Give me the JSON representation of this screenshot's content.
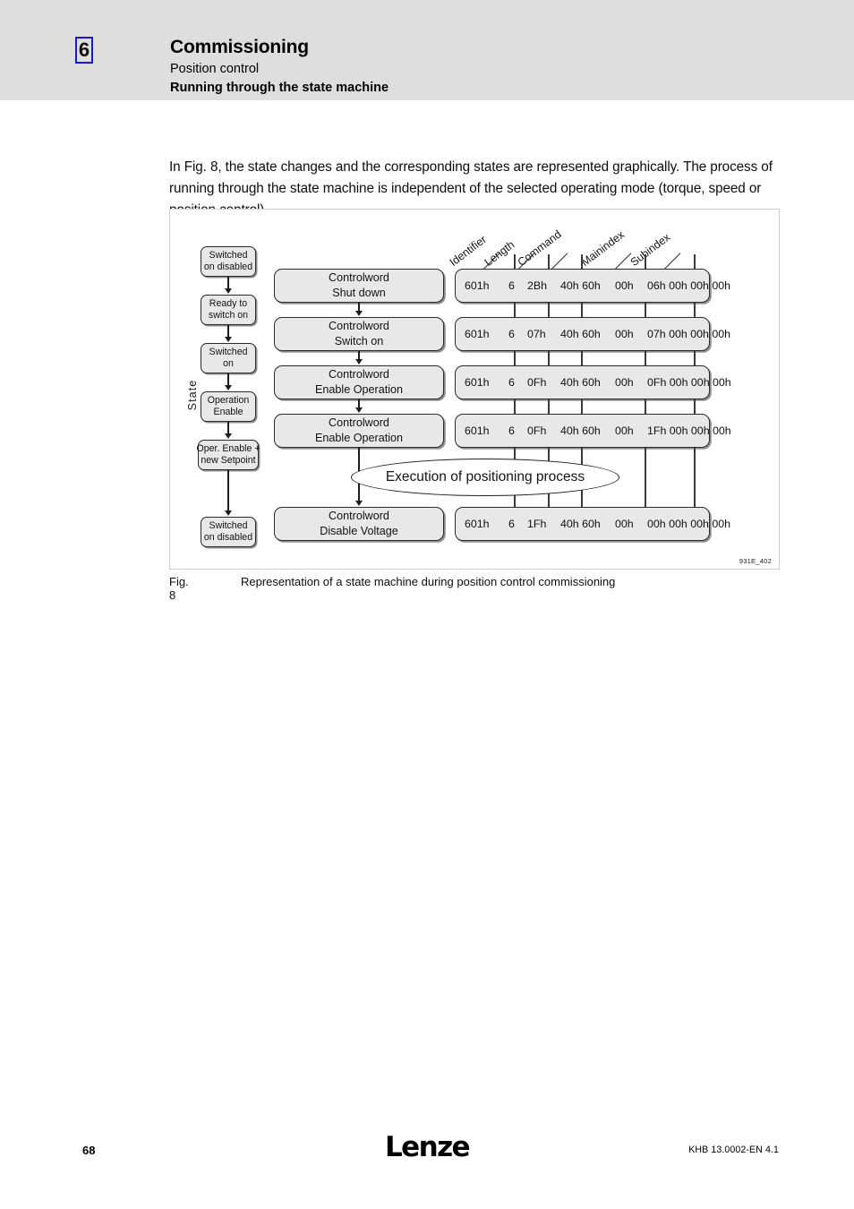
{
  "header": {
    "chapter_number": "6",
    "title": "Commissioning",
    "subtitle_1": "Position control",
    "subtitle_2": "Running through the state machine"
  },
  "body": {
    "intro_paragraph": "In Fig. 8, the state changes and the corresponding states are represented graphically. The process of running through the state machine is independent of the selected operating mode (torque, speed or position control)."
  },
  "figure": {
    "id_label": "931E_402",
    "axis_label": "State",
    "ellipse_label": "Execution of positioning process",
    "column_headers": [
      "Identifier",
      "Length",
      "Command",
      "Mainindex",
      "Subindex"
    ],
    "states": [
      {
        "line1": "Switched",
        "line2": "on disabled"
      },
      {
        "line1": "Ready to",
        "line2": "switch on"
      },
      {
        "line1": "Switched",
        "line2": "on"
      },
      {
        "line1": "Operation",
        "line2": "Enable"
      },
      {
        "line1": "Oper. Enable +",
        "line2": "new Setpoint"
      },
      {
        "line1": "Switched",
        "line2": "on disabled"
      }
    ],
    "controlwords": [
      {
        "line1": "Controlword",
        "line2": "Shut down"
      },
      {
        "line1": "Controlword",
        "line2": "Switch on"
      },
      {
        "line1": "Controlword",
        "line2": "Enable Operation"
      },
      {
        "line1": "Controlword",
        "line2": "Enable Operation"
      },
      {
        "line1": "Controlword",
        "line2": "Disable Voltage"
      }
    ],
    "telegrams": [
      {
        "identifier": "601h",
        "length": "6",
        "command": "2Bh",
        "mainindex": "40h 60h",
        "subindex": "00h",
        "data": "06h 00h 00h 00h"
      },
      {
        "identifier": "601h",
        "length": "6",
        "command": "07h",
        "mainindex": "40h 60h",
        "subindex": "00h",
        "data": "07h 00h 00h 00h"
      },
      {
        "identifier": "601h",
        "length": "6",
        "command": "0Fh",
        "mainindex": "40h 60h",
        "subindex": "00h",
        "data": "0Fh 00h 00h 00h"
      },
      {
        "identifier": "601h",
        "length": "6",
        "command": "0Fh",
        "mainindex": "40h 60h",
        "subindex": "00h",
        "data": "1Fh 00h 00h 00h"
      },
      {
        "identifier": "601h",
        "length": "6",
        "command": "1Fh",
        "mainindex": "40h 60h",
        "subindex": "00h",
        "data": "00h 00h 00h 00h"
      }
    ]
  },
  "caption": {
    "label": "Fig. 8",
    "text": "Representation of a state machine during position control commissioning"
  },
  "footer": {
    "page_number": "68",
    "logo": "Lenze",
    "document_id": "KHB 13.0002-EN   4.1"
  },
  "colors": {
    "header_band": "#dededd",
    "chapter_accent": "#1616e8",
    "box_fill": "#e8e8e8",
    "box_border": "#2b2b2b"
  }
}
